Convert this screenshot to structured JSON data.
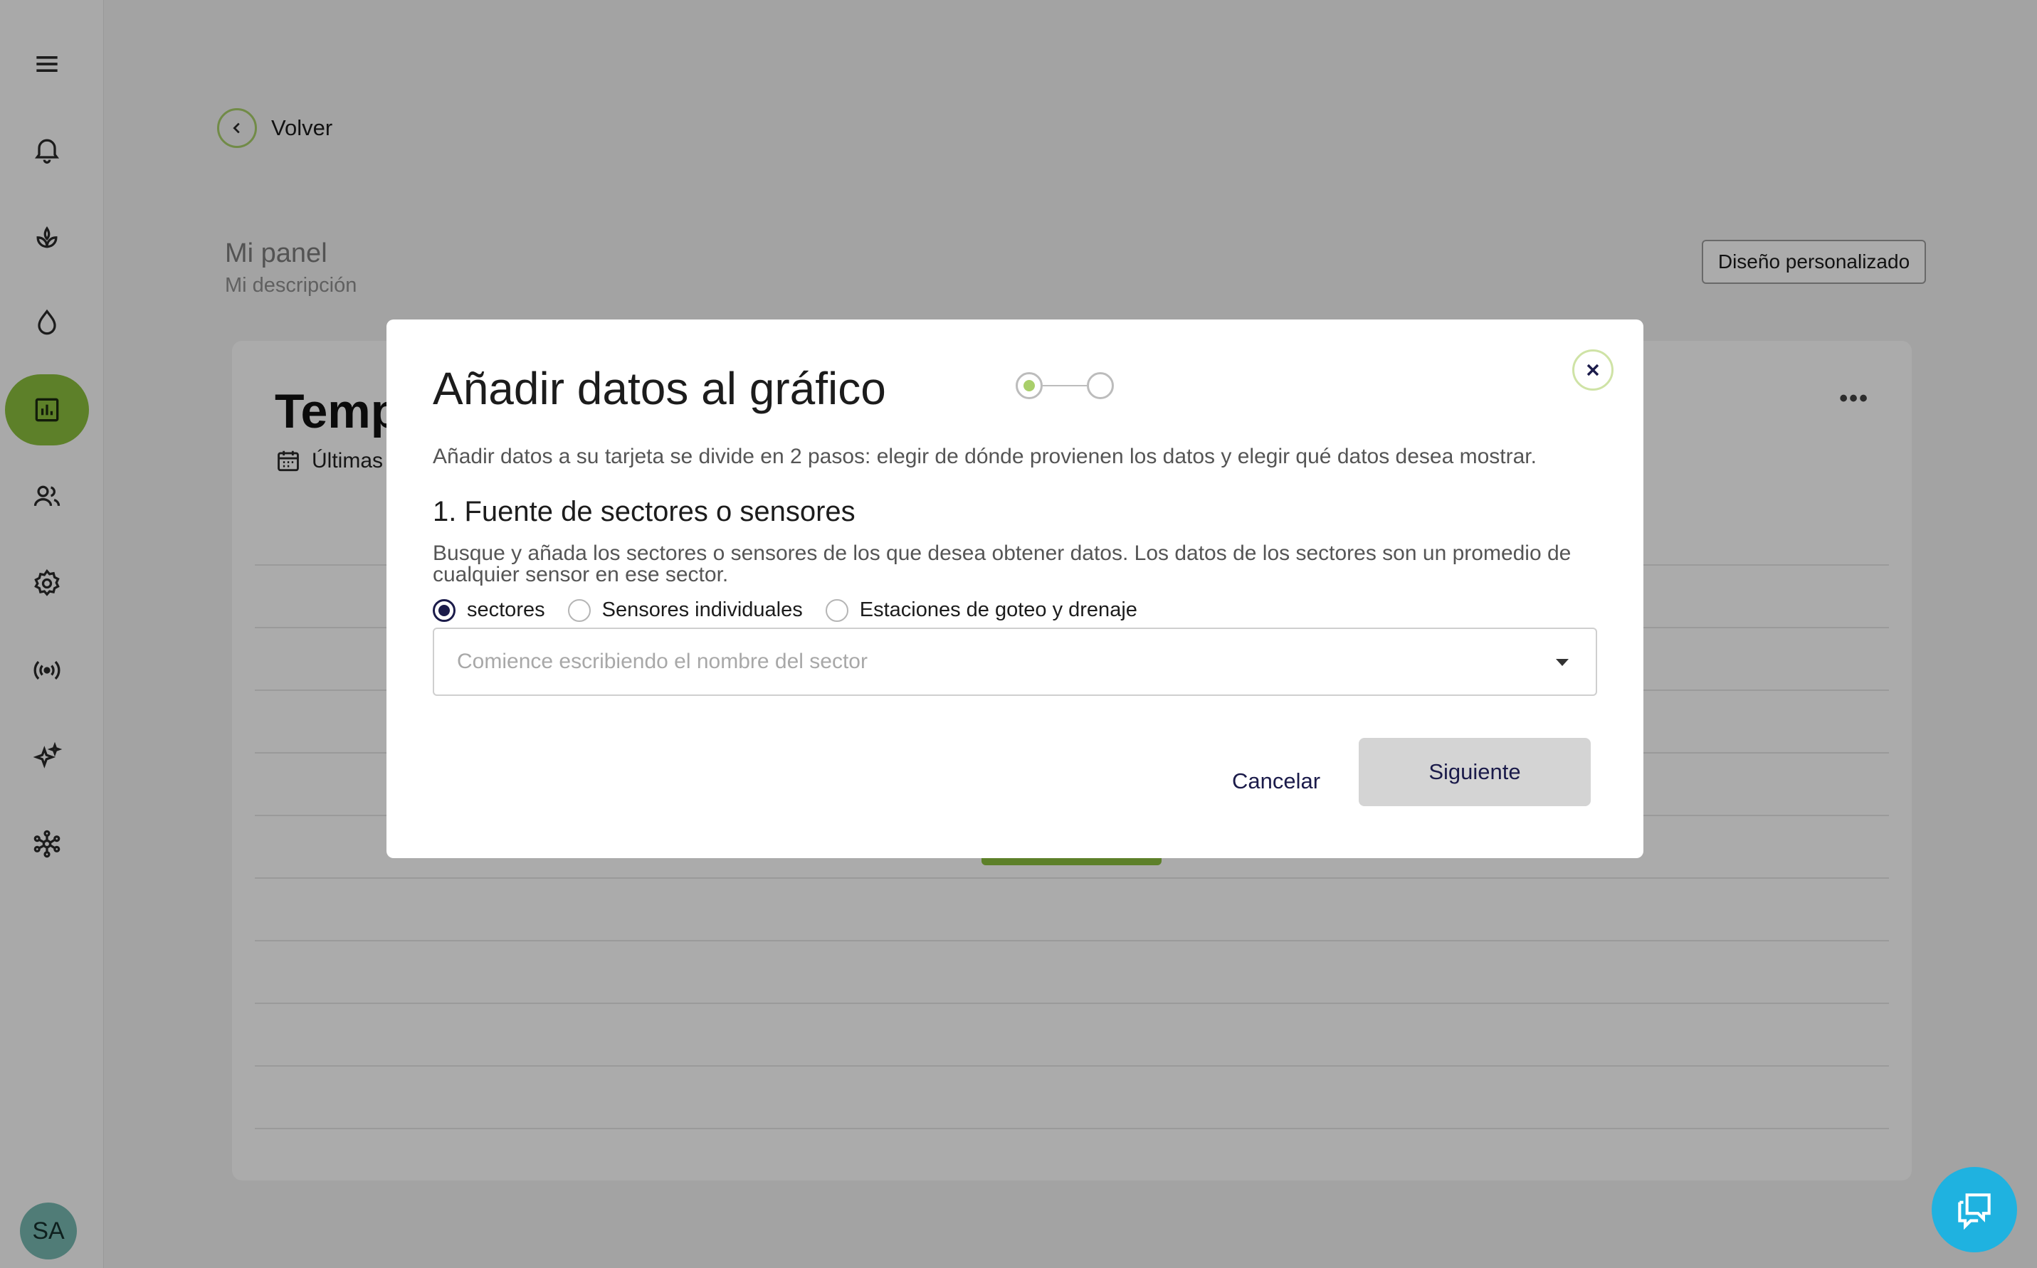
{
  "sidebar": {
    "items": [
      {
        "icon": "menu-icon"
      },
      {
        "icon": "bell-icon"
      },
      {
        "icon": "plant-icon"
      },
      {
        "icon": "water-drop-icon"
      },
      {
        "icon": "chart-icon",
        "active": true
      },
      {
        "icon": "users-icon"
      },
      {
        "icon": "gear-icon"
      },
      {
        "icon": "broadcast-icon"
      },
      {
        "icon": "sparkle-icon"
      },
      {
        "icon": "network-icon"
      }
    ],
    "avatar_initials": "SA"
  },
  "header": {
    "back_label": "Volver"
  },
  "panel": {
    "title": "Mi panel",
    "description": "Mi descripción",
    "design_button": "Diseño personalizado"
  },
  "card": {
    "title": "Temp",
    "range_label": "Últimas",
    "more_label": "•••"
  },
  "modal": {
    "title": "Añadir datos al gráfico",
    "intro": "Añadir datos a su tarjeta se divide en 2 pasos: elegir de dónde provienen los datos y elegir qué datos desea mostrar.",
    "section_title": "1. Fuente de sectores o sensores",
    "section_desc": "Busque y añada los sectores o sensores de los que desea obtener datos. Los datos de los sectores son un promedio de cualquier sensor en ese sector.",
    "source_options": [
      {
        "label": "sectores",
        "selected": true
      },
      {
        "label": "Sensores individuales",
        "selected": false
      },
      {
        "label": "Estaciones de goteo y drenaje",
        "selected": false
      }
    ],
    "search_placeholder": "Comience escribiendo el nombre del sector",
    "cancel_label": "Cancelar",
    "next_label": "Siguiente",
    "step_current": 1,
    "step_total": 2
  },
  "colors": {
    "accent_green": "#8bbf3e",
    "navy_text": "#1b1b4a",
    "chat_blue": "#1fb2e0"
  }
}
